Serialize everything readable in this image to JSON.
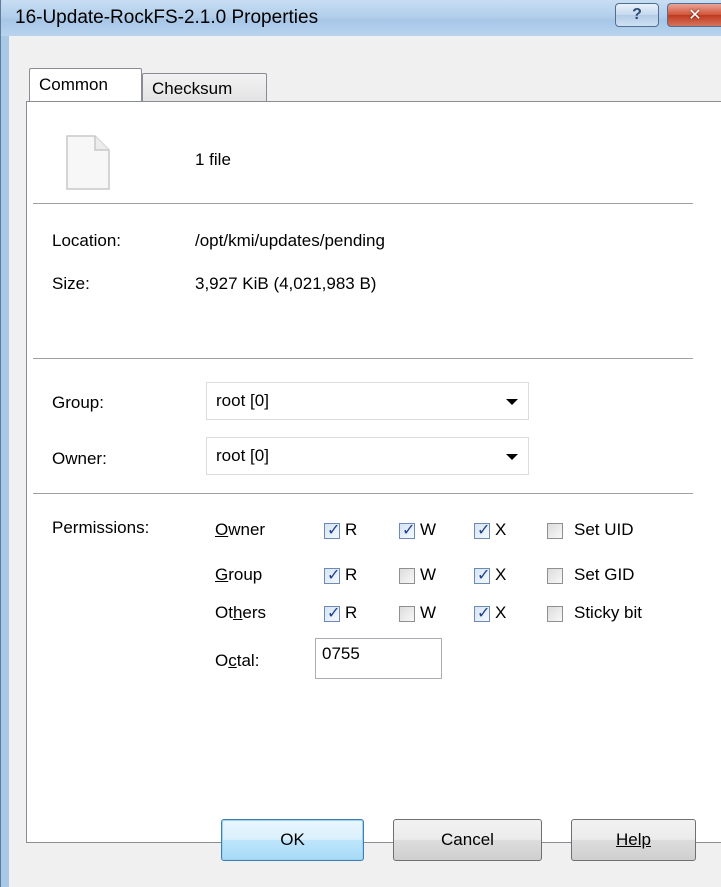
{
  "window": {
    "title": "16-Update-RockFS-2.1.0 Properties",
    "help_glyph": "?",
    "close_glyph": "✕"
  },
  "tabs": [
    {
      "label": "Common",
      "active": true
    },
    {
      "label": "Checksum",
      "active": false
    }
  ],
  "summary": {
    "icon": "file-icon",
    "file_count": "1 file"
  },
  "info": {
    "location_label": "Location:",
    "location_value": "/opt/kmi/updates/pending",
    "size_label": "Size:",
    "size_value": "3,927 KiB (4,021,983 B)"
  },
  "ownership": {
    "group_label": "Group:",
    "group_value": "root [0]",
    "owner_label": "Owner:",
    "owner_value": "root [0]"
  },
  "permissions": {
    "label": "Permissions:",
    "rows": [
      {
        "who": "Owner",
        "r": true,
        "w": true,
        "x": true,
        "special_label": "Set UID",
        "special": false
      },
      {
        "who": "Group",
        "r": true,
        "w": false,
        "x": true,
        "special_label": "Set GID",
        "special": false
      },
      {
        "who": "Others",
        "r": true,
        "w": false,
        "x": true,
        "special_label": "Sticky bit",
        "special": false
      }
    ],
    "r_label": "R",
    "w_label": "W",
    "x_label": "X",
    "octal_label": "Octal:",
    "octal_value": "0755"
  },
  "buttons": {
    "ok": "OK",
    "cancel": "Cancel",
    "help": "Help"
  },
  "colors": {
    "titlebar": "#b3cfeb",
    "close_button": "#c03a1f",
    "checkmark": "#1f3f8a"
  }
}
